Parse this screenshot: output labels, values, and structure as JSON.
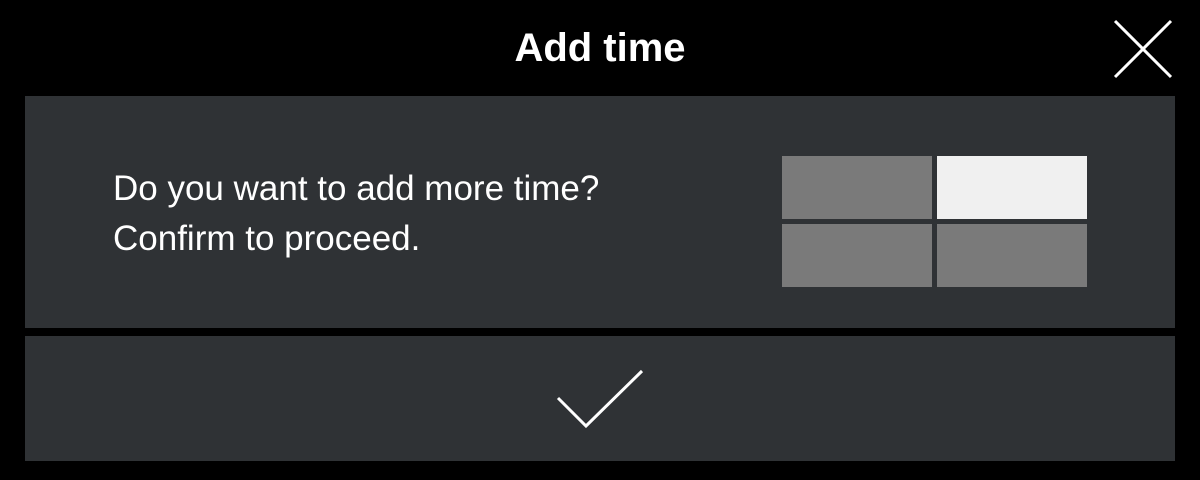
{
  "dialog": {
    "title": "Add time"
  },
  "message": {
    "line1": "Do you want to add more time?",
    "line2": "Confirm to proceed."
  },
  "icons": {
    "close": "close-icon",
    "confirm": "checkmark-icon"
  },
  "colors": {
    "background": "#000000",
    "panel": "#2f3235",
    "text": "#ffffff",
    "tile_inactive": "#7a7a7a",
    "tile_active": "#f0f0f0"
  }
}
